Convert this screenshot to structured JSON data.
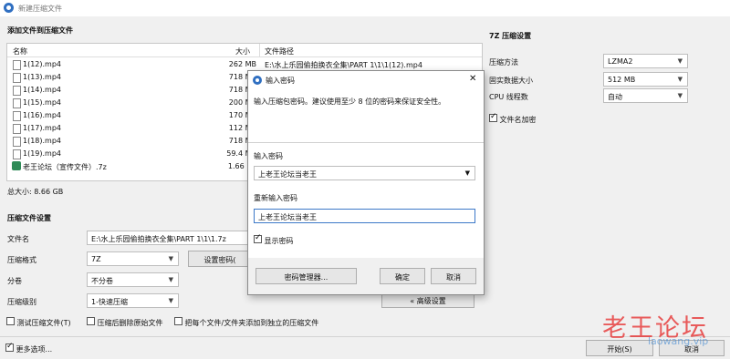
{
  "window": {
    "title": "新建压缩文件"
  },
  "files_section": {
    "title": "添加文件到压缩文件",
    "columns": {
      "name": "名称",
      "size": "大小",
      "path": "文件路径"
    },
    "rows": [
      {
        "name": "1(12).mp4",
        "size": "262 MB",
        "path": "E:\\水上乐园偷拍换衣全集\\PART 1\\1\\1(12).mp4"
      },
      {
        "name": "1(13).mp4",
        "size": "718 MB",
        "path": ""
      },
      {
        "name": "1(14).mp4",
        "size": "718 MB",
        "path": ""
      },
      {
        "name": "1(15).mp4",
        "size": "200 MB",
        "path": ""
      },
      {
        "name": "1(16).mp4",
        "size": "170 MB",
        "path": ""
      },
      {
        "name": "1(17).mp4",
        "size": "112 MB",
        "path": ""
      },
      {
        "name": "1(18).mp4",
        "size": "718 MB",
        "path": ""
      },
      {
        "name": "1(19).mp4",
        "size": "59.4 MB",
        "path": ""
      },
      {
        "name": "老王论坛（宣传文件）.7z",
        "size": "1.66 KB",
        "path": ""
      }
    ],
    "total": "总大小: 8.66 GB"
  },
  "compress_settings": {
    "title": "压缩文件设置",
    "filename_label": "文件名",
    "filename_value": "E:\\水上乐园偷拍换衣全集\\PART 1\\1\\1.7z",
    "format_label": "压缩格式",
    "format_value": "7Z",
    "set_password_label": "设置密码(",
    "volume_label": "分卷",
    "volume_value": "不分卷",
    "level_label": "压缩级别",
    "level_value": "1-快速压缩",
    "advanced_label": "« 高级设置",
    "opt_test": "测试压缩文件(T)",
    "opt_delete": "压缩后删除原始文件",
    "opt_separate": "把每个文件/文件夹添加到独立的压缩文件"
  },
  "seven_z": {
    "title": "7Z 压缩设置",
    "method_label": "压缩方法",
    "method_value": "LZMA2",
    "dict_label": "固实数据大小",
    "dict_value": "512 MB",
    "threads_label": "CPU 线程数",
    "threads_value": "自动",
    "encrypt_names": "文件名加密"
  },
  "bottom": {
    "more_options": "更多选项...",
    "start_label": "开始(S)",
    "cancel_label": "取消"
  },
  "password_dialog": {
    "title": "输入密码",
    "close_symbol": "✕",
    "hint": "输入压缩包密码。建议使用至少 8 位的密码来保证安全性。",
    "enter_label": "输入密码",
    "enter_value": "上老王论坛当老王",
    "reenter_label": "重新输入密码",
    "reenter_value": "上老王论坛当老王",
    "show_password": "显示密码",
    "manager_label": "密码管理器...",
    "ok_label": "确定",
    "cancel_label": "取消"
  },
  "watermark": {
    "text": "老王论坛",
    "url": "laowang.vip"
  }
}
